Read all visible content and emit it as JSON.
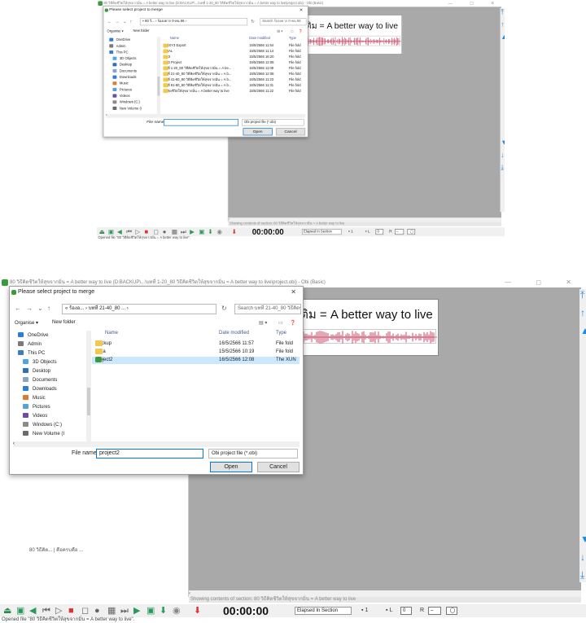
{
  "window": {
    "title": "80 วิธีคิดชีวิตให้สุขจากมิ่น = A better way to live (D:BACKUP\\...\\บทที่ 1-20_80 วิธีคิดชีวิตให้สุขจากมิ่น = A better way to live\\project.obi) - Obi (Basic)",
    "controls": "— ◻ ✕"
  },
  "strip": {
    "title": "เติม = A better way to live"
  },
  "section_status": "Showing contents of section:  80 วิธีคิดชีวิตให้สุขจากมิ่น = A better way to live",
  "left_panel_text": "80 วิธีคิด... | คือครบคือ ...",
  "toolbar": {
    "timecode": "00:00:00",
    "elapsed": "Elapsed In Section",
    "page_value": "1",
    "l_label": "L",
    "l_value": "0",
    "r_label": "R"
  },
  "statusbar": "Opened file \"80 วิธีคิดชีวิตให้สุขจากมิ่น = A better way to live\".",
  "top_dialog": {
    "title": "Please select project to merge",
    "path": "« 80 วิ... › ร้องอยาก 0-คน 66 ›",
    "search": "Search ร้องอยาก 0-คน 66",
    "organise": "Organise ▾",
    "new_folder": "New folder",
    "col_name": "Name",
    "col_date": "Date modified",
    "col_type": "Type",
    "nav": [
      {
        "label": "OneDrive",
        "color": "#2a7fd4"
      },
      {
        "label": "Admin",
        "color": "#7a7a7a"
      },
      {
        "label": "This PC",
        "color": "#3a7fc4"
      },
      {
        "label": "3D Objects",
        "color": "#4aa6e8"
      },
      {
        "label": "Desktop",
        "color": "#2e6fb8"
      },
      {
        "label": "Documents",
        "color": "#8aa4c8"
      },
      {
        "label": "Downloads",
        "color": "#2a7fd4"
      },
      {
        "label": "Music",
        "color": "#e07a2a"
      },
      {
        "label": "Pictures",
        "color": "#5aa0d8"
      },
      {
        "label": "Videos",
        "color": "#6a4ab0"
      },
      {
        "label": "Windows (C:)",
        "color": "#8a8a8a"
      },
      {
        "label": "New Volume (I",
        "color": "#6a6a6a"
      }
    ],
    "files": [
      {
        "name": "DAISY3 Export",
        "date": "15/5/2566 11:54",
        "type": "File fold",
        "kind": "folder",
        "selected": true
      },
      {
        "name": "FINAL",
        "date": "15/5/2566 11:14",
        "type": "File fold",
        "kind": "folder",
        "selected": false
      },
      {
        "name": "MP3",
        "date": "15/5/2566 16:20",
        "type": "File fold",
        "kind": "folder",
        "selected": false
      },
      {
        "name": "OLD Project",
        "date": "16/5/2566 12:08",
        "type": "File fold",
        "kind": "folder",
        "selected": false
      },
      {
        "name": "บทที่ 1-20_80 วิธีคิดชีวิตให้สุขจากมิ่น = A be...",
        "date": "16/5/2566 11:09",
        "type": "File fold",
        "kind": "folder",
        "selected": false
      },
      {
        "name": "บทที่ 21-40_80 วิธีคิดชีวิตให้สุขจากมิ่น = A b...",
        "date": "16/5/2566 12:08",
        "type": "File fold",
        "kind": "folder",
        "selected": true
      },
      {
        "name": "บทที่ 41-60_80 วิธีคิดชีวิตให้สุขจากมิ่น = A b...",
        "date": "16/5/2566 11:23",
        "type": "File fold",
        "kind": "folder",
        "selected": false
      },
      {
        "name": "บทที่ 61-80_80 วิธีคิดชีวิตให้สุขจากมิ่น = A b...",
        "date": "16/5/2566 11:31",
        "type": "File fold",
        "kind": "folder",
        "selected": false
      },
      {
        "name": "วิธีคิดชีวิตให้สุขจากมิ่น = A better way to live",
        "date": "15/5/2566 11:22",
        "type": "File fold",
        "kind": "folder",
        "selected": false
      }
    ],
    "file_name_label": "File name:",
    "file_name_value": "",
    "file_type": "Obi project file (*.obi)",
    "open": "Open",
    "cancel": "Cancel"
  },
  "bottom_dialog": {
    "title": "Please select project to merge",
    "path": "« ร้องอ... › บทที่ 21-40_80 ... ›",
    "search": "Search บทที่ 21-40_80 วิธีคิดชี...",
    "organise": "Organise ▾",
    "new_folder": "New folder",
    "col_name": "Name",
    "col_date": "Date modified",
    "col_type": "Type",
    "nav": [
      {
        "label": "OneDrive",
        "color": "#2a7fd4"
      },
      {
        "label": "Admin",
        "color": "#7a7a7a"
      },
      {
        "label": "This PC",
        "color": "#3a7fc4"
      },
      {
        "label": "3D Objects",
        "color": "#4aa6e8"
      },
      {
        "label": "Desktop",
        "color": "#2e6fb8"
      },
      {
        "label": "Documents",
        "color": "#8aa4c8"
      },
      {
        "label": "Downloads",
        "color": "#2a7fd4"
      },
      {
        "label": "Music",
        "color": "#e07a2a"
      },
      {
        "label": "Pictures",
        "color": "#5aa0d8"
      },
      {
        "label": "Videos",
        "color": "#6a4ab0"
      },
      {
        "label": "Windows (C:)",
        "color": "#8a8a8a"
      },
      {
        "label": "New Volume (I",
        "color": "#6a6a6a"
      }
    ],
    "files": [
      {
        "name": "Backup",
        "date": "16/5/2566 11:57",
        "type": "File fold",
        "kind": "folder",
        "selected": false
      },
      {
        "name": "Data",
        "date": "15/5/2566 10:19",
        "type": "File fold",
        "kind": "folder",
        "selected": false
      },
      {
        "name": "project2",
        "date": "16/5/2566 12:08",
        "type": "The XUN",
        "kind": "obi",
        "selected": true
      }
    ],
    "file_name_label": "File name:",
    "file_name_value": "project2",
    "file_type": "Obi project file (*.obi)",
    "open": "Open",
    "cancel": "Cancel"
  }
}
